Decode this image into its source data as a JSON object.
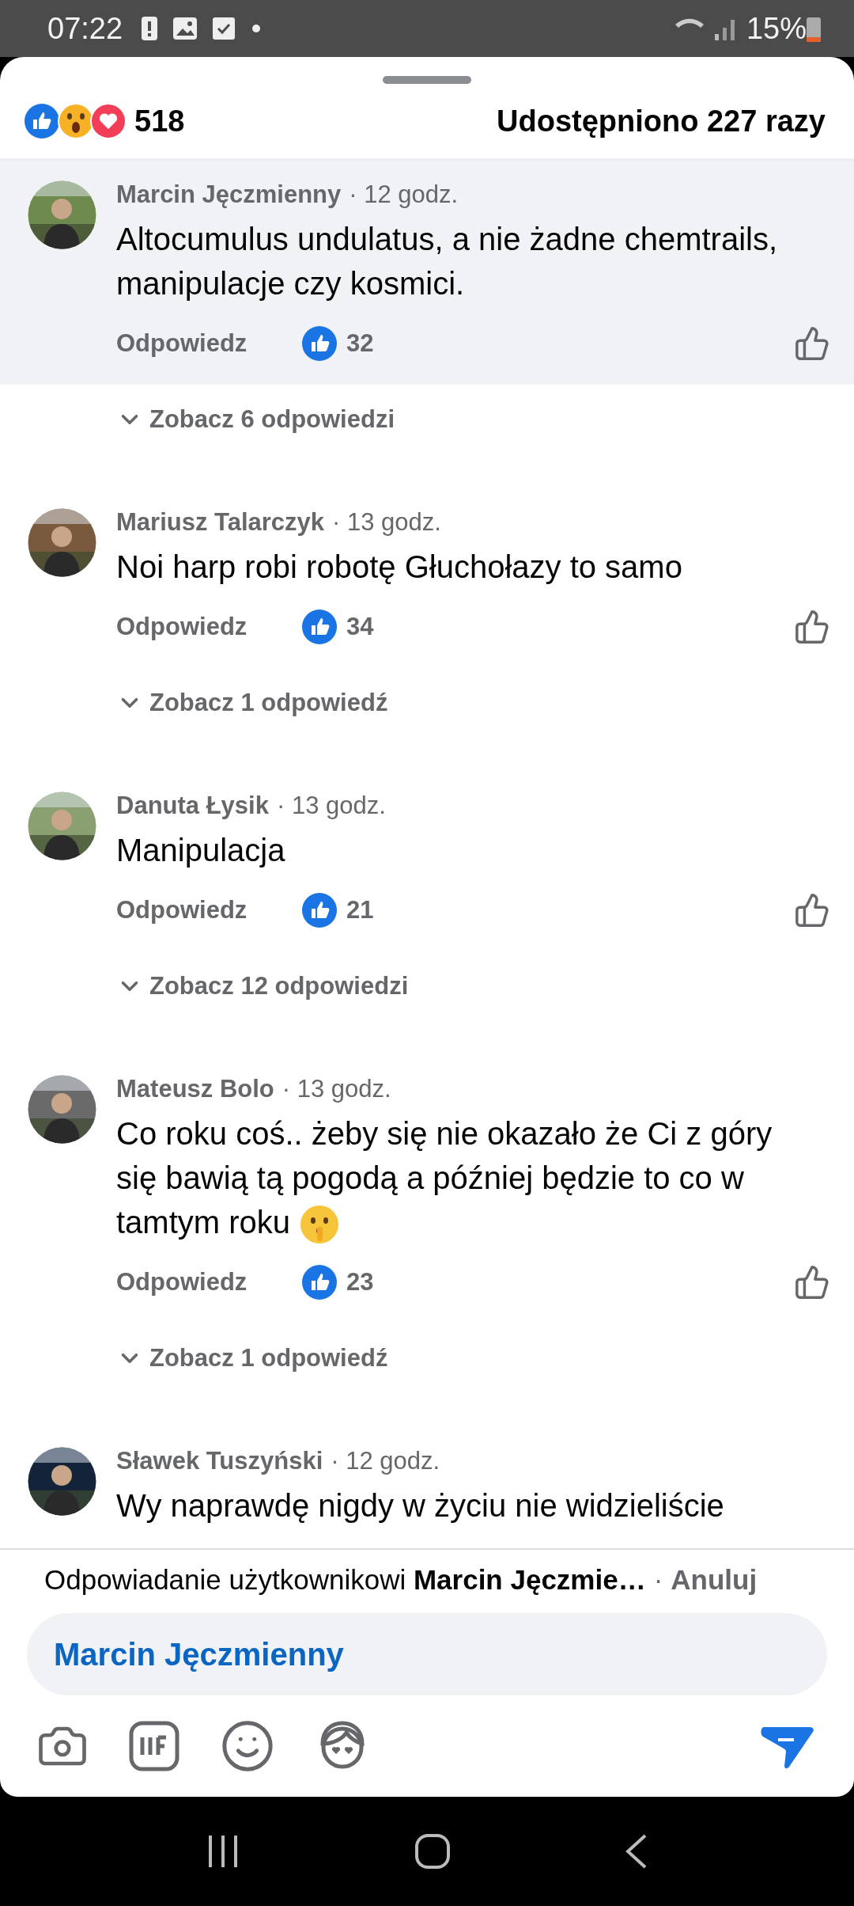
{
  "status_bar": {
    "time": "07:22",
    "battery": "15%"
  },
  "header": {
    "reactions_count": "518",
    "shares": "Udostępniono 227 razy"
  },
  "comments": [
    {
      "author": "Marcin Jęczmienny",
      "time": "· 12 godz.",
      "body": "Altocumulus undulatus, a nie żadne chemtrails, manipulacje czy kosmici.",
      "has_emoji": false,
      "reply_label": "Odpowiedz",
      "likes": "32",
      "highlighted": true,
      "replies_link": "Zobacz 6 odpowiedzi"
    },
    {
      "author": "Mariusz Talarczyk",
      "time": "· 13 godz.",
      "body": "Noi harp robi robotę Głuchołazy to samo",
      "has_emoji": false,
      "reply_label": "Odpowiedz",
      "likes": "34",
      "highlighted": false,
      "replies_link": "Zobacz 1 odpowiedź"
    },
    {
      "author": "Danuta Łysik",
      "time": "· 13 godz.",
      "body": "Manipulacja",
      "has_emoji": false,
      "reply_label": "Odpowiedz",
      "likes": "21",
      "highlighted": false,
      "replies_link": "Zobacz 12 odpowiedzi"
    },
    {
      "author": "Mateusz Bolo",
      "time": "· 13 godz.",
      "body": "Co roku coś.. żeby się nie okazało że Ci z góry się bawią tą pogodą a później będzie to co w tamtym roku",
      "has_emoji": true,
      "reply_label": "Odpowiedz",
      "likes": "23",
      "highlighted": false,
      "replies_link": "Zobacz 1 odpowiedź"
    },
    {
      "author": "Sławek Tuszyński",
      "time": "· 12 godz.",
      "body": "Wy naprawdę nigdy w życiu nie widzieliście",
      "has_emoji": false,
      "highlighted": false
    }
  ],
  "reply_bar": {
    "context": "Odpowiadanie użytkownikowi **Marcin Jęczmie…**",
    "separator": "·",
    "cancel": "Anuluj",
    "input_value": "Marcin Jęczmienny"
  }
}
